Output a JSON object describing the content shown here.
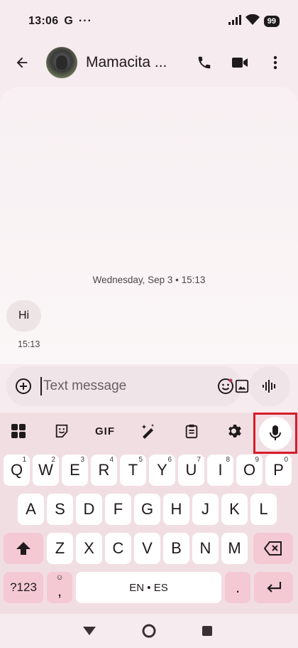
{
  "status_bar": {
    "time": "13:06",
    "g_label": "G",
    "dots": "···",
    "battery": "99"
  },
  "app_bar": {
    "contact_name": "Mamacita ...",
    "icons": [
      "back-arrow-icon",
      "phone-icon",
      "video-call-icon",
      "more-vert-icon"
    ]
  },
  "conversation": {
    "date_header": "Wednesday, Sep 3 • 15:13",
    "messages": [
      {
        "text": "Hi",
        "time": "15:13"
      }
    ]
  },
  "compose": {
    "placeholder": "Text message"
  },
  "keyboard": {
    "toolbar": {
      "gif_label": "GIF",
      "icons": [
        "apps-grid-icon",
        "sticker-icon",
        "gif-icon",
        "magic-edit-icon",
        "clipboard-icon",
        "gear-icon",
        "microphone-icon"
      ]
    },
    "row1": [
      {
        "k": "Q",
        "h": "1"
      },
      {
        "k": "W",
        "h": "2"
      },
      {
        "k": "E",
        "h": "3"
      },
      {
        "k": "R",
        "h": "4"
      },
      {
        "k": "T",
        "h": "5"
      },
      {
        "k": "Y",
        "h": "6"
      },
      {
        "k": "U",
        "h": "7"
      },
      {
        "k": "I",
        "h": "8"
      },
      {
        "k": "O",
        "h": "9"
      },
      {
        "k": "P",
        "h": "0"
      }
    ],
    "row2": [
      "A",
      "S",
      "D",
      "F",
      "G",
      "H",
      "J",
      "K",
      "L"
    ],
    "row3": [
      "Z",
      "X",
      "C",
      "V",
      "B",
      "N",
      "M"
    ],
    "symbols_label": "?123",
    "comma_label": ",",
    "space_label": "EN • ES",
    "period_label": "."
  },
  "colors": {
    "accent_highlight": "#d81b2b",
    "keyboard_bg": "#f1dee3",
    "special_key": "#f4c9d3"
  }
}
